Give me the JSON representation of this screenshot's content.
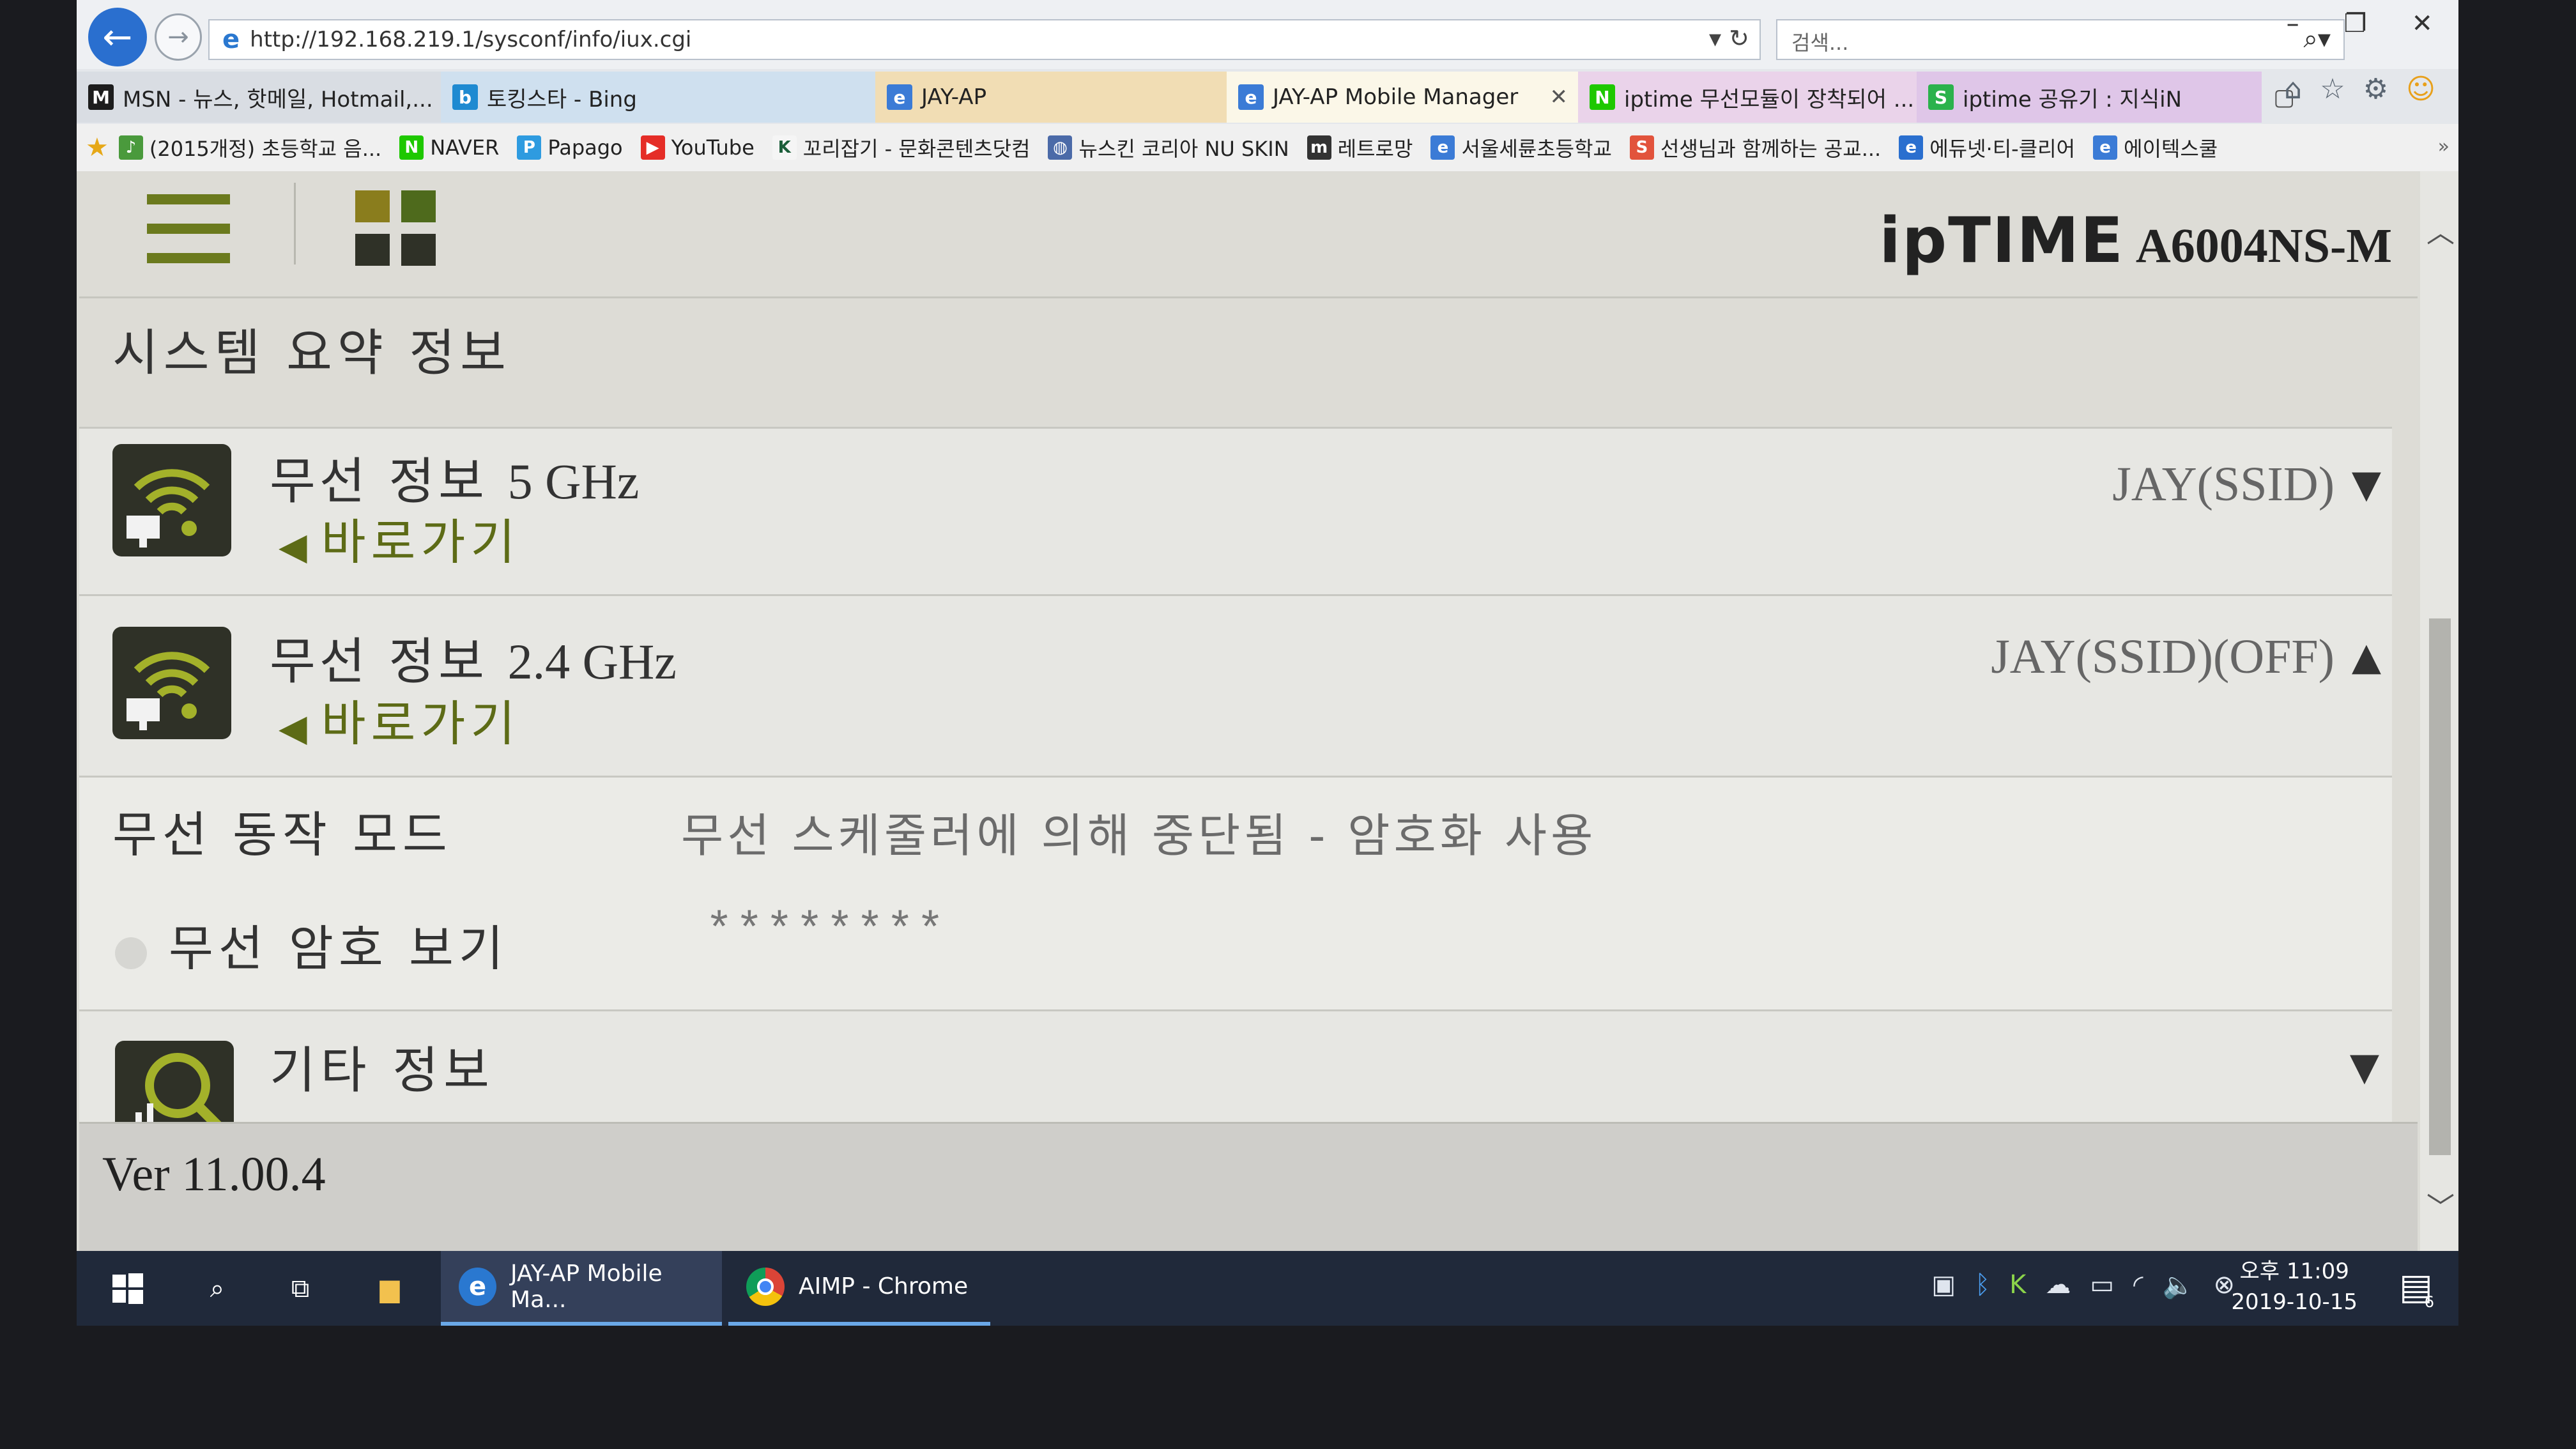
{
  "browser": {
    "url": "http://192.168.219.1/sysconf/info/iux.cgi",
    "search_placeholder": "검색...",
    "tabs": [
      {
        "label": "MSN - 뉴스, 핫메일, Hotmail,..."
      },
      {
        "label": "토킹스타 - Bing"
      },
      {
        "label": "JAY-AP"
      },
      {
        "label": "JAY-AP Mobile Manager"
      },
      {
        "label": "iptime 무선모듈이 장착되어 ..."
      },
      {
        "label": "iptime 공유기 : 지식iN"
      }
    ],
    "favorites": [
      {
        "label": "(2015개정) 초등학교 음..."
      },
      {
        "label": "NAVER"
      },
      {
        "label": "Papago"
      },
      {
        "label": "YouTube"
      },
      {
        "label": "꼬리잡기 - 문화콘텐츠닷컴"
      },
      {
        "label": "뉴스킨 코리아 NU SKIN"
      },
      {
        "label": "레트로망"
      },
      {
        "label": "서울세륜초등학교"
      },
      {
        "label": "선생님과 함께하는 공교..."
      },
      {
        "label": "에듀넷·티-클리어"
      },
      {
        "label": "에이텍스쿨"
      }
    ]
  },
  "router": {
    "brand": "ipTIME",
    "model": "A6004NS-M",
    "page_title": "시스템 요약 정보",
    "wireless_5g": {
      "title_prefix": "무선 정보",
      "title_band": "5 GHz",
      "link": "바로가기",
      "ssid": "JAY(SSID)"
    },
    "wireless_24g": {
      "title_prefix": "무선 정보",
      "title_band": "2.4 GHz",
      "link": "바로가기",
      "ssid": "JAY(SSID)(OFF)"
    },
    "mode_label": "무선 동작 모드",
    "mode_value": "무선 스케줄러에 의해 중단됨 - 암호화 사용",
    "password_label": "무선 암호 보기",
    "password_value": "********",
    "etc_label": "기타 정보",
    "version": "Ver 11.00.4"
  },
  "taskbar": {
    "apps": [
      {
        "label": "JAY-AP Mobile Ma..."
      },
      {
        "label": "AIMP - Chrome"
      }
    ],
    "clock_time": "오후 11:09",
    "clock_date": "2019-10-15",
    "notification_count": "6"
  },
  "colors": {
    "accent_olive": "#6b7a1e",
    "link_olive": "#5d6b16",
    "taskbar": "#20293a"
  }
}
